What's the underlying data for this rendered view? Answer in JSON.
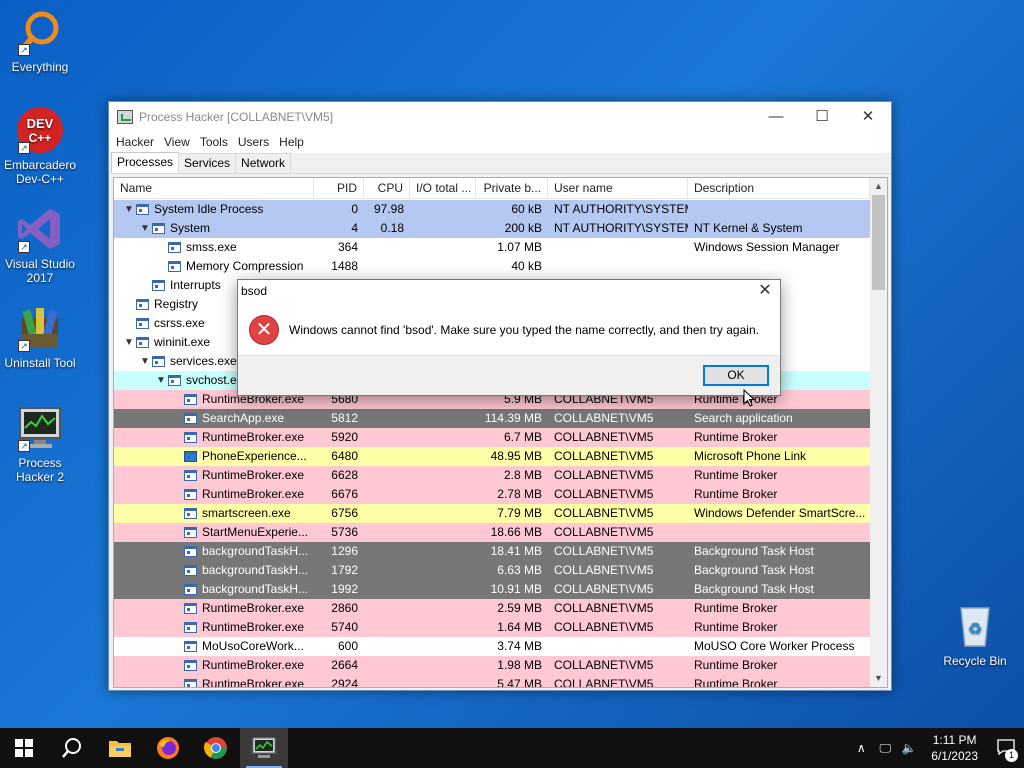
{
  "desktop": {
    "icons": [
      {
        "label": "Everything",
        "icon": "everything-search-icon"
      },
      {
        "label": "Embarcadero Dev-C++",
        "icon": "dev-cpp-icon",
        "badge": "DEV C++"
      },
      {
        "label": "Visual Studio 2017",
        "icon": "visual-studio-icon"
      },
      {
        "label": "Uninstall Tool",
        "icon": "uninstall-tool-icon"
      },
      {
        "label": "Process Hacker 2",
        "icon": "process-hacker-icon"
      },
      {
        "label": "Recycle Bin",
        "icon": "recycle-bin-icon"
      }
    ]
  },
  "window": {
    "title": "Process Hacker [COLLABNET\\VM5]",
    "controls": {
      "minimize": "—",
      "maximize": "☐",
      "close": "✕"
    },
    "menu": [
      "Hacker",
      "View",
      "Tools",
      "Users",
      "Help"
    ],
    "tabs": [
      "Processes",
      "Services",
      "Network"
    ],
    "active_tab": "Processes"
  },
  "columns": [
    "Name",
    "PID",
    "CPU",
    "I/O total ...",
    "Private b...",
    "User name",
    "Description"
  ],
  "rows": [
    {
      "indent": 0,
      "toggle": "▼",
      "name": "System Idle Process",
      "pid": "0",
      "cpu": "97.98",
      "io": "",
      "priv": "60 kB",
      "user": "NT AUTHORITY\\SYSTEM",
      "desc": "",
      "color": "blue"
    },
    {
      "indent": 1,
      "toggle": "▼",
      "name": "System",
      "pid": "4",
      "cpu": "0.18",
      "io": "",
      "priv": "200 kB",
      "user": "NT AUTHORITY\\SYSTEM",
      "desc": "NT Kernel & System",
      "color": "blue"
    },
    {
      "indent": 2,
      "toggle": "",
      "name": "smss.exe",
      "pid": "364",
      "cpu": "",
      "io": "",
      "priv": "1.07 MB",
      "user": "",
      "desc": "Windows Session Manager",
      "color": "white"
    },
    {
      "indent": 2,
      "toggle": "",
      "name": "Memory Compression",
      "pid": "1488",
      "cpu": "",
      "io": "",
      "priv": "40 kB",
      "user": "",
      "desc": "",
      "color": "white"
    },
    {
      "indent": 1,
      "toggle": "",
      "name": "Interrupts",
      "pid": "",
      "cpu": "",
      "io": "",
      "priv": "",
      "user": "",
      "desc": "PCs",
      "color": "white"
    },
    {
      "indent": 0,
      "toggle": "",
      "name": "Registry",
      "pid": "",
      "cpu": "",
      "io": "",
      "priv": "",
      "user": "",
      "desc": "",
      "color": "white"
    },
    {
      "indent": 0,
      "toggle": "",
      "name": "csrss.exe",
      "pid": "",
      "cpu": "",
      "io": "",
      "priv": "",
      "user": "",
      "desc": "ntime Process",
      "color": "white"
    },
    {
      "indent": 0,
      "toggle": "▼",
      "name": "wininit.exe",
      "pid": "",
      "cpu": "",
      "io": "",
      "priv": "",
      "user": "",
      "desc": "Up Application",
      "color": "white"
    },
    {
      "indent": 1,
      "toggle": "▼",
      "name": "services.exe",
      "pid": "",
      "cpu": "",
      "io": "",
      "priv": "",
      "user": "",
      "desc": "ntroller app",
      "color": "white"
    },
    {
      "indent": 2,
      "toggle": "▼",
      "name": "svchost.e",
      "pid": "",
      "cpu": "",
      "io": "",
      "priv": "",
      "user": "",
      "desc": "Windows Ser...",
      "color": "cyan"
    },
    {
      "indent": 3,
      "toggle": "",
      "name": "RuntimeBroker.exe",
      "pid": "5680",
      "cpu": "",
      "io": "",
      "priv": "5.9 MB",
      "user": "COLLABNET\\VM5",
      "desc": "Runtime Broker",
      "color": "pink"
    },
    {
      "indent": 3,
      "toggle": "",
      "name": "SearchApp.exe",
      "pid": "5812",
      "cpu": "",
      "io": "",
      "priv": "114.39 MB",
      "user": "COLLABNET\\VM5",
      "desc": "Search application",
      "color": "gray"
    },
    {
      "indent": 3,
      "toggle": "",
      "name": "RuntimeBroker.exe",
      "pid": "5920",
      "cpu": "",
      "io": "",
      "priv": "6.7 MB",
      "user": "COLLABNET\\VM5",
      "desc": "Runtime Broker",
      "color": "pink"
    },
    {
      "indent": 3,
      "toggle": "",
      "name": "PhoneExperience...",
      "pid": "6480",
      "cpu": "",
      "io": "",
      "priv": "48.95 MB",
      "user": "COLLABNET\\VM5",
      "desc": "Microsoft Phone Link",
      "color": "yellow",
      "icon": "phone"
    },
    {
      "indent": 3,
      "toggle": "",
      "name": "RuntimeBroker.exe",
      "pid": "6628",
      "cpu": "",
      "io": "",
      "priv": "2.8 MB",
      "user": "COLLABNET\\VM5",
      "desc": "Runtime Broker",
      "color": "pink"
    },
    {
      "indent": 3,
      "toggle": "",
      "name": "RuntimeBroker.exe",
      "pid": "6676",
      "cpu": "",
      "io": "",
      "priv": "2.78 MB",
      "user": "COLLABNET\\VM5",
      "desc": "Runtime Broker",
      "color": "pink"
    },
    {
      "indent": 3,
      "toggle": "",
      "name": "smartscreen.exe",
      "pid": "6756",
      "cpu": "",
      "io": "",
      "priv": "7.79 MB",
      "user": "COLLABNET\\VM5",
      "desc": "Windows Defender SmartScre...",
      "color": "yellow"
    },
    {
      "indent": 3,
      "toggle": "",
      "name": "StartMenuExperie...",
      "pid": "5736",
      "cpu": "",
      "io": "",
      "priv": "18.66 MB",
      "user": "COLLABNET\\VM5",
      "desc": "",
      "color": "pink"
    },
    {
      "indent": 3,
      "toggle": "",
      "name": "backgroundTaskH...",
      "pid": "1296",
      "cpu": "",
      "io": "",
      "priv": "18.41 MB",
      "user": "COLLABNET\\VM5",
      "desc": "Background Task Host",
      "color": "gray"
    },
    {
      "indent": 3,
      "toggle": "",
      "name": "backgroundTaskH...",
      "pid": "1792",
      "cpu": "",
      "io": "",
      "priv": "6.63 MB",
      "user": "COLLABNET\\VM5",
      "desc": "Background Task Host",
      "color": "gray"
    },
    {
      "indent": 3,
      "toggle": "",
      "name": "backgroundTaskH...",
      "pid": "1992",
      "cpu": "",
      "io": "",
      "priv": "10.91 MB",
      "user": "COLLABNET\\VM5",
      "desc": "Background Task Host",
      "color": "gray"
    },
    {
      "indent": 3,
      "toggle": "",
      "name": "RuntimeBroker.exe",
      "pid": "2860",
      "cpu": "",
      "io": "",
      "priv": "2.59 MB",
      "user": "COLLABNET\\VM5",
      "desc": "Runtime Broker",
      "color": "pink"
    },
    {
      "indent": 3,
      "toggle": "",
      "name": "RuntimeBroker.exe",
      "pid": "5740",
      "cpu": "",
      "io": "",
      "priv": "1.64 MB",
      "user": "COLLABNET\\VM5",
      "desc": "Runtime Broker",
      "color": "pink"
    },
    {
      "indent": 3,
      "toggle": "",
      "name": "MoUsoCoreWork...",
      "pid": "600",
      "cpu": "",
      "io": "",
      "priv": "3.74 MB",
      "user": "",
      "desc": "MoUSO Core Worker Process",
      "color": "white"
    },
    {
      "indent": 3,
      "toggle": "",
      "name": "RuntimeBroker.exe",
      "pid": "2664",
      "cpu": "",
      "io": "",
      "priv": "1.98 MB",
      "user": "COLLABNET\\VM5",
      "desc": "Runtime Broker",
      "color": "pink"
    },
    {
      "indent": 3,
      "toggle": "",
      "name": "RuntimeBroker.exe",
      "pid": "2924",
      "cpu": "",
      "io": "",
      "priv": "5.47 MB",
      "user": "COLLABNET\\VM5",
      "desc": "Runtime Broker",
      "color": "pink"
    }
  ],
  "dialog": {
    "title": "bsod",
    "close": "✕",
    "message": "Windows cannot find 'bsod'. Make sure you typed the name correctly, and then try again.",
    "ok_label": "OK",
    "icon": "error-icon"
  },
  "taskbar": {
    "apps": [
      "start-icon",
      "search-icon",
      "file-explorer-icon",
      "firefox-icon",
      "chrome-icon",
      "process-hacker-taskbar-icon"
    ],
    "time": "1:11 PM",
    "date": "6/1/2023",
    "notification_count": "1"
  }
}
